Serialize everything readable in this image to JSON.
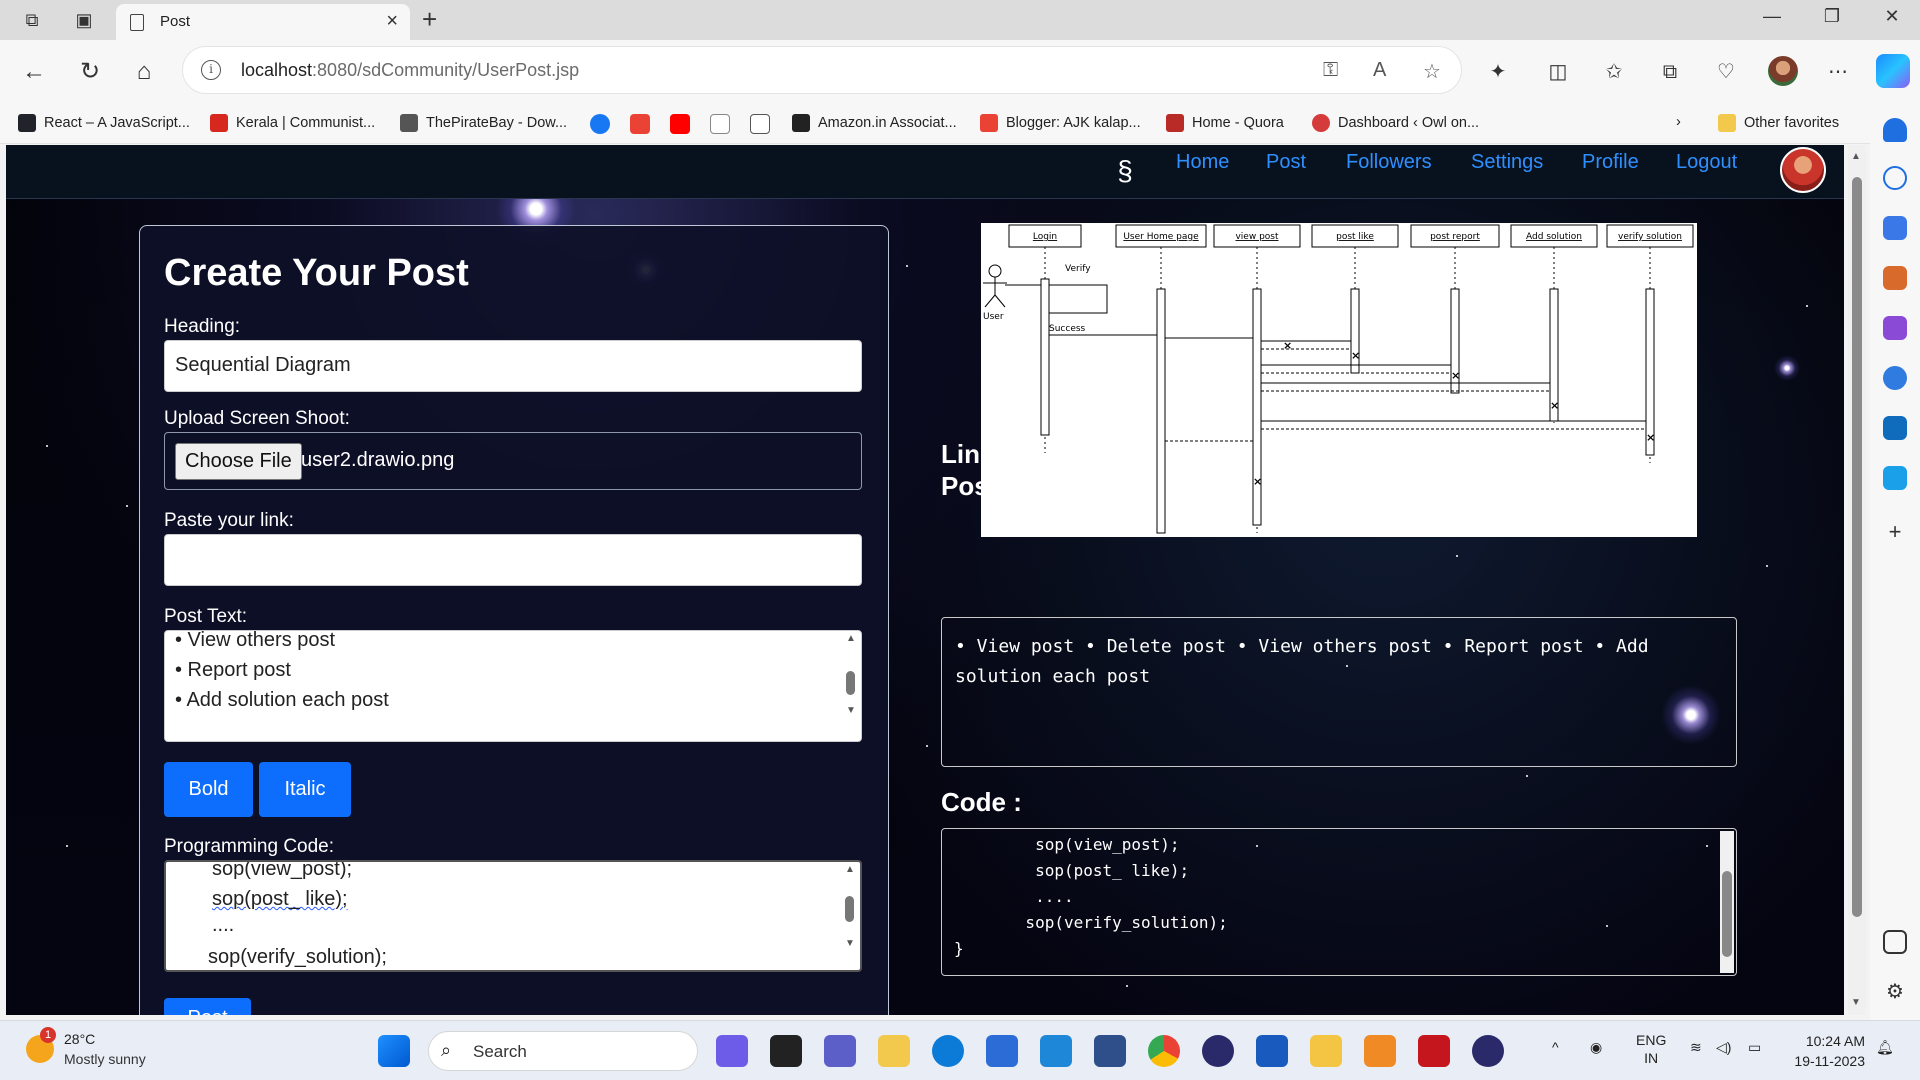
{
  "browser": {
    "tab_title": "Post",
    "url_host": "localhost",
    "url_rest": ":8080/sdCommunity/UserPost.jsp",
    "bookmarks": [
      {
        "label": "React – A JavaScript...",
        "color": "#20232a"
      },
      {
        "label": "Kerala | Communist...",
        "color": "#d6281e"
      },
      {
        "label": "ThePirateBay - Dow...",
        "color": "#555555"
      },
      {
        "label": "Amazon.in Associat...",
        "color": "#222222"
      },
      {
        "label": "Blogger: AJK kalap...",
        "color": "#ea4335"
      },
      {
        "label": "Home - Quora",
        "color": "#b92b27"
      },
      {
        "label": "Dashboard ‹ Owl on...",
        "color": "#d63b3b"
      }
    ],
    "other_favorites": "Other favorites"
  },
  "site": {
    "nav": [
      "Home",
      "Post",
      "Followers",
      "Settings",
      "Profile",
      "Logout"
    ],
    "accent": "#2f8fff"
  },
  "form": {
    "title": "Create Your Post",
    "heading_label": "Heading:",
    "heading_value": "Sequential Diagram",
    "upload_label": "Upload Screen Shoot:",
    "choose_file": "Choose File",
    "file_name": "user2.drawio.png",
    "link_label": "Paste your link:",
    "link_value": "",
    "post_text_label": "Post Text:",
    "post_text_lines": [
      "•      View others post",
      "•       Report post",
      "•      Add solution each post"
    ],
    "bold_label": "Bold",
    "italic_label": "Italic",
    "code_label": "Programming Code:",
    "code_lines": [
      "sop(view_post);",
      "sop(post_ like);",
      "....",
      "sop(verify_solution);"
    ],
    "post_button": "Post"
  },
  "diagram": {
    "lifelines": [
      "Login",
      "User Home page",
      "view post",
      "post like",
      "post report",
      "Add solution",
      "verify solution"
    ],
    "actor": "User",
    "verify": "Verify",
    "success": "Success"
  },
  "preview": {
    "link_label": "Link :",
    "post_label": "Post :",
    "post_text": "• View post • Delete post • View others post • Report post • Add solution each post",
    "code_label": "Code :",
    "code_lines": [
      "        sop(view_post);",
      "        sop(post_ like);",
      "        ....",
      "       sop(verify_solution);",
      "}"
    ]
  },
  "taskbar": {
    "temp": "28°C",
    "weather": "Mostly sunny",
    "weather_badge": "1",
    "search": "Search",
    "lang1": "ENG",
    "lang2": "IN",
    "time": "10:24 AM",
    "date": "19-11-2023"
  }
}
